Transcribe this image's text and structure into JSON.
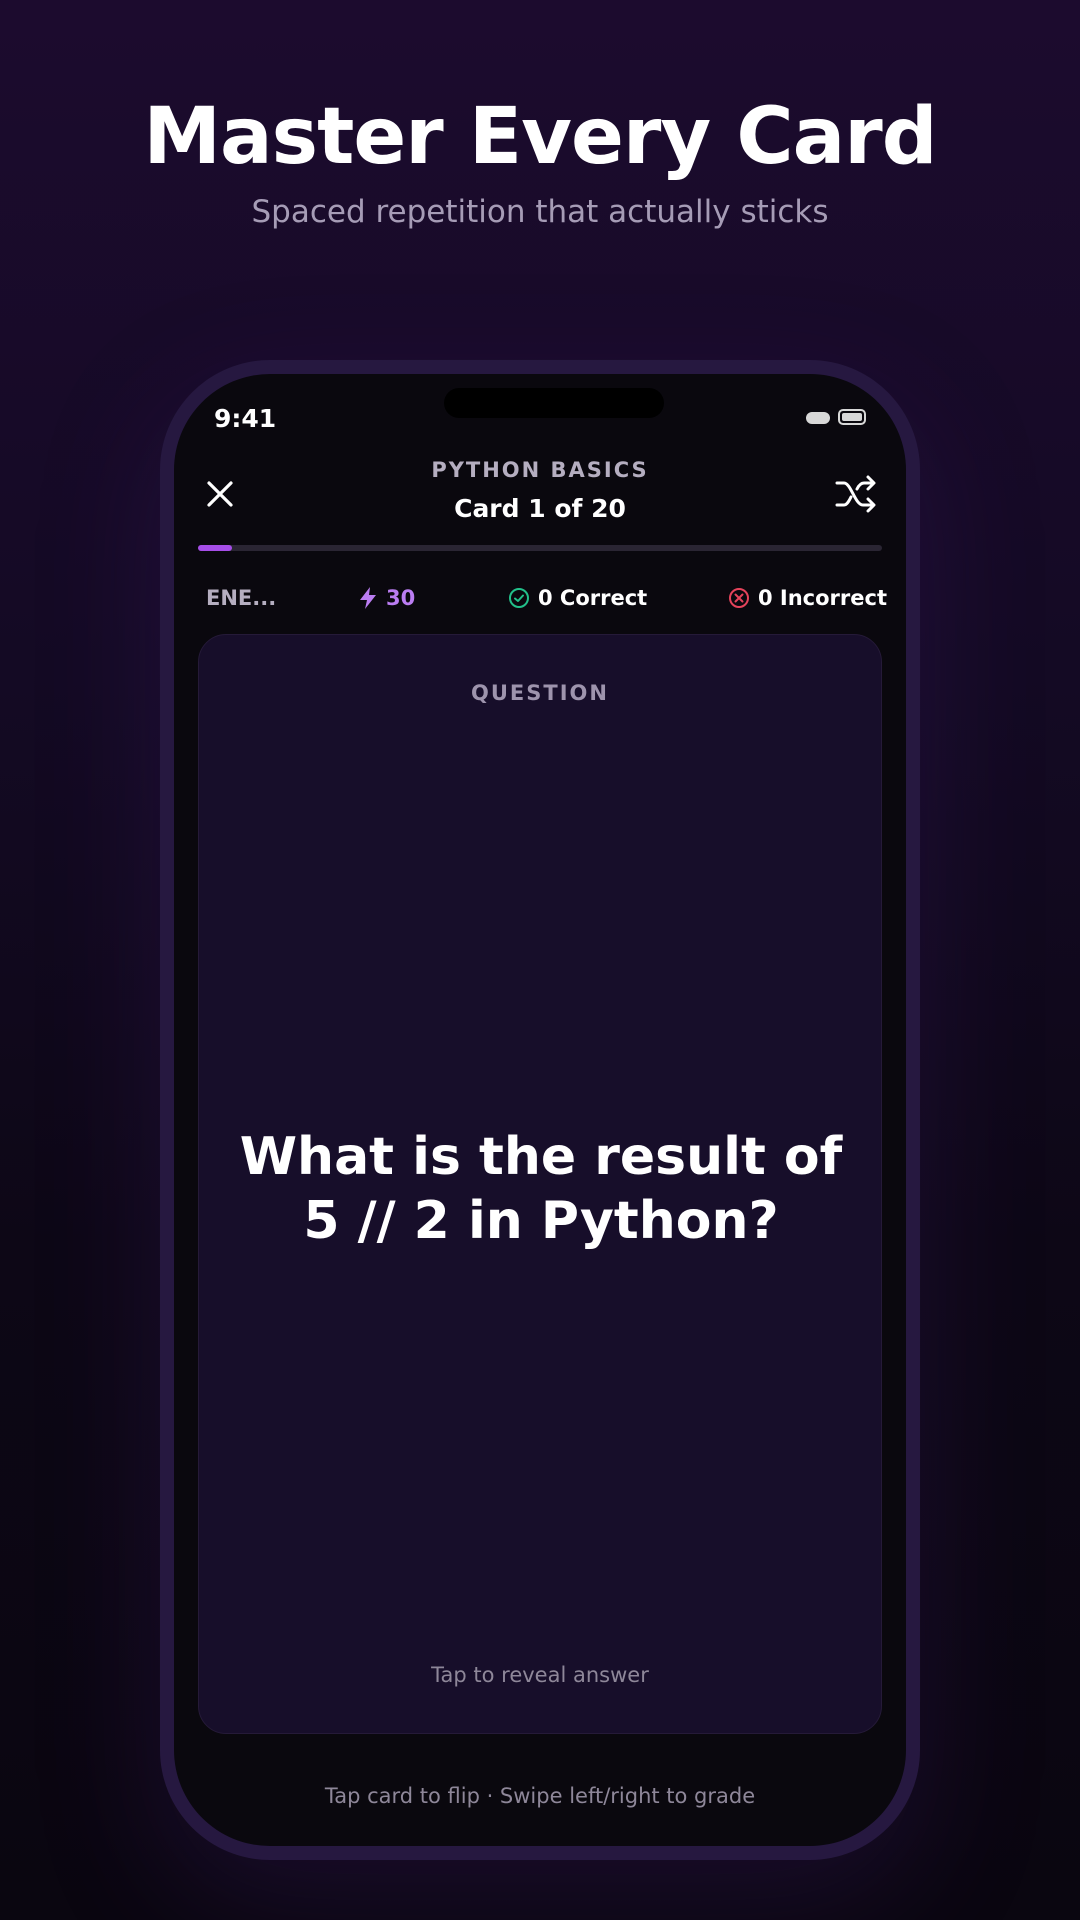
{
  "hero": {
    "title": "Master Every Card",
    "subtitle": "Spaced repetition that actually sticks"
  },
  "status_bar": {
    "time": "9:41"
  },
  "header": {
    "deck_name": "PYTHON BASICS",
    "card_counter": "Card 1 of 20",
    "close_icon": "close-icon",
    "shuffle_icon": "shuffle-icon"
  },
  "progress": {
    "current": 1,
    "total": 20,
    "fraction": 0.05
  },
  "stats": {
    "energy_label": "ENE...",
    "xp": "30",
    "correct": "0 Correct",
    "incorrect": "0 Incorrect"
  },
  "card": {
    "label": "QUESTION",
    "question": "What is the result of 5 // 2 in Python?",
    "hint": "Tap to reveal answer"
  },
  "footer": {
    "hint": "Tap card to flip · Swipe left/right to grade"
  },
  "colors": {
    "accent": "#a64ee8",
    "xp": "#bb7df2",
    "correct": "#22c08a",
    "incorrect": "#e5435b",
    "card_bg": "#170e2a"
  }
}
